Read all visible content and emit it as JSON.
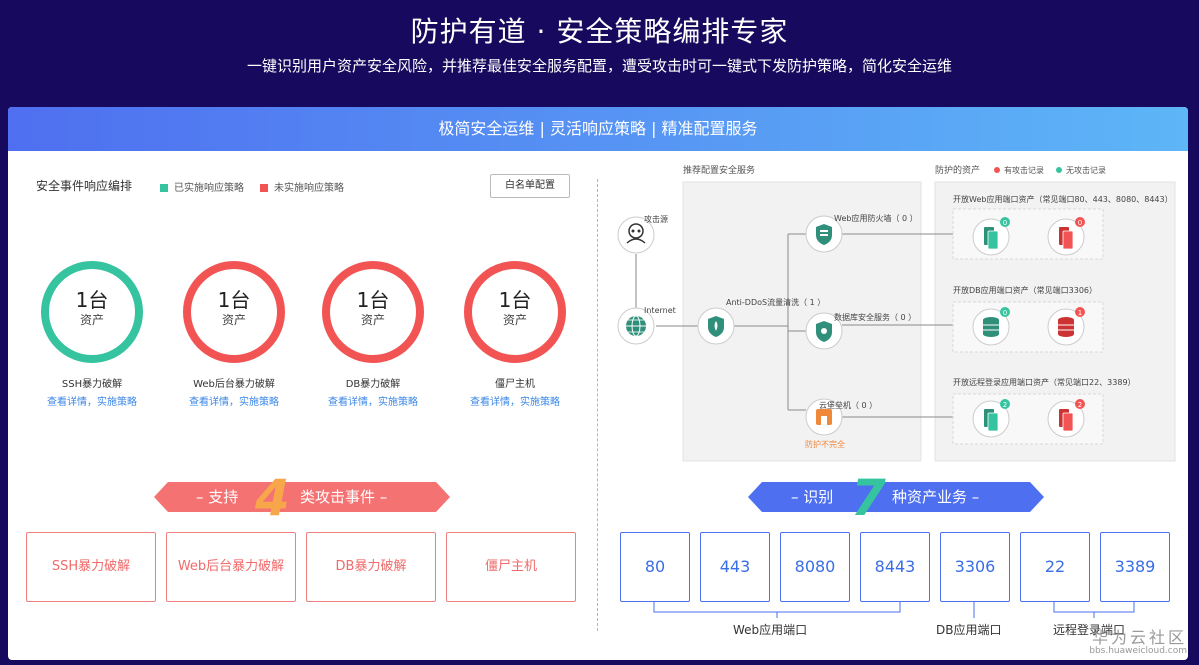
{
  "hero": {
    "title": "防护有道 · 安全策略编排专家",
    "subtitle": "一键识别用户资产安全风险，并推荐最佳安全服务配置，遭受攻击时可一键式下发防护策略，简化安全运维"
  },
  "panel_header": "极简安全运维 | 灵活响应策略 | 精准配置服务",
  "left": {
    "title": "安全事件响应编排",
    "legend": [
      {
        "label": "已实施响应策略",
        "color": "#36c3a0"
      },
      {
        "label": "未实施响应策略",
        "color": "#f25454"
      }
    ],
    "whitelist_button": "白名单配置",
    "rings": [
      {
        "count": "1台",
        "unit": "资产",
        "label": "SSH暴力破解",
        "link": "查看详情，实施策略",
        "color": "#36c3a0"
      },
      {
        "count": "1台",
        "unit": "资产",
        "label": "Web后台暴力破解",
        "link": "查看详情，实施策略",
        "color": "#f25454"
      },
      {
        "count": "1台",
        "unit": "资产",
        "label": "DB暴力破解",
        "link": "查看详情，实施策略",
        "color": "#f25454"
      },
      {
        "count": "1台",
        "unit": "资产",
        "label": "僵尸主机",
        "link": "查看详情，实施策略",
        "color": "#f25454"
      }
    ],
    "ribbon": {
      "pre": "– 支持",
      "num": "4",
      "post": "类攻击事件 –"
    },
    "attack_types": [
      "SSH暴力破解",
      "Web后台暴力破解",
      "DB暴力破解",
      "僵尸主机"
    ]
  },
  "diagram": {
    "recommend_title": "推荐配置安全服务",
    "protected_title": "防护的资产",
    "legend_attacked": "有攻击记录",
    "legend_clean": "无攻击记录",
    "attack_source": "攻击源",
    "internet": "Internet",
    "anti_ddos": "Anti-DDoS流量清洗（ 1 ）",
    "waf": "Web应用防火墙（ 0 ）",
    "dbss": "数据库安全服务（ 0 ）",
    "bastion": "云堡垒机（ 0 ）",
    "bastion_warning": "防护不完全",
    "group_web": "开放Web应用端口资产（常见端口80、443、8080、8443）",
    "group_db": "开放DB应用端口资产（常见端口3306）",
    "group_remote": "开放远程登录应用端口资产（常见端口22、3389）",
    "badges": {
      "web_ok": "0",
      "web_bad": "0",
      "db_ok": "0",
      "db_bad": "1",
      "rl_ok": "2",
      "rl_bad": "2"
    },
    "colors": {
      "green": "#36c3a0",
      "red": "#f25454",
      "blue": "#3a6ee6"
    }
  },
  "right": {
    "ribbon": {
      "pre": "– 识别",
      "num": "7",
      "post": "种资产业务 –"
    },
    "ports": [
      "80",
      "443",
      "8080",
      "8443",
      "3306",
      "22",
      "3389"
    ],
    "port_groups": [
      "Web应用端口",
      "DB应用端口",
      "远程登录端口"
    ]
  },
  "watermark": {
    "line1": "华为云社区",
    "line2": "bbs.huaweicloud.com"
  }
}
